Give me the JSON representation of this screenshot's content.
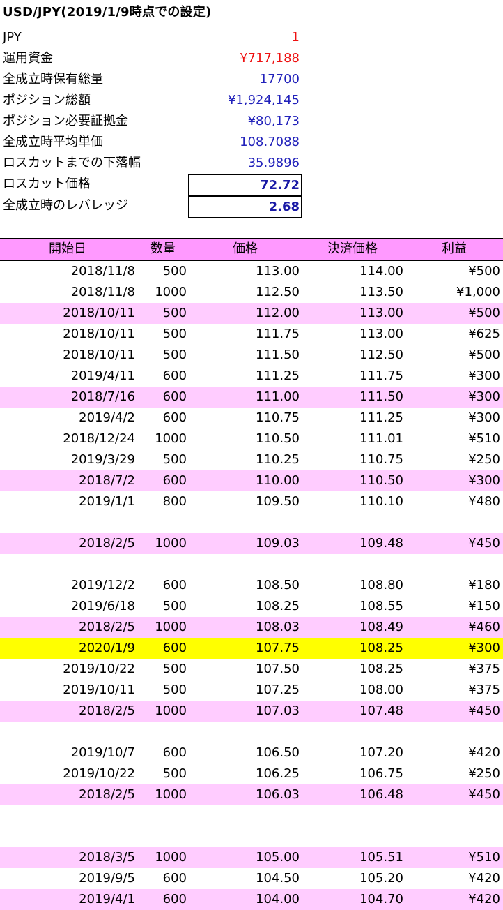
{
  "title": "USD/JPY(2019/1/9時点での設定)",
  "summary": [
    {
      "label": "JPY",
      "value": "1",
      "color": "red"
    },
    {
      "label": "運用資金",
      "value": "¥717,188",
      "color": "red"
    },
    {
      "label": "全成立時保有総量",
      "value": "17700",
      "color": "blue"
    },
    {
      "label": "ポジション総額",
      "value": "¥1,924,145",
      "color": "blue"
    },
    {
      "label": "ポジション必要証拠金",
      "value": "¥80,173",
      "color": "blue"
    },
    {
      "label": "全成立時平均単価",
      "value": "108.7088",
      "color": "blue"
    },
    {
      "label": "ロスカットまでの下落幅",
      "value": "35.9896",
      "color": "blue"
    },
    {
      "label": "ロスカット価格",
      "value": "72.72",
      "color": "bold"
    },
    {
      "label": "全成立時のレバレッジ",
      "value": "2.68",
      "color": "bold"
    }
  ],
  "table": {
    "headers": [
      "開始日",
      "数量",
      "価格",
      "決済価格",
      "利益"
    ],
    "rows": [
      {
        "bg": "white",
        "cells": [
          "2018/11/8",
          "500",
          "113.00",
          "114.00",
          "¥500"
        ]
      },
      {
        "bg": "white",
        "cells": [
          "2018/11/8",
          "1000",
          "112.50",
          "113.50",
          "¥1,000"
        ]
      },
      {
        "bg": "pink",
        "cells": [
          "2018/10/11",
          "500",
          "112.00",
          "113.00",
          "¥500"
        ]
      },
      {
        "bg": "white",
        "cells": [
          "2018/10/11",
          "500",
          "111.75",
          "113.00",
          "¥625"
        ]
      },
      {
        "bg": "white",
        "cells": [
          "2018/10/11",
          "500",
          "111.50",
          "112.50",
          "¥500"
        ]
      },
      {
        "bg": "white",
        "cells": [
          "2019/4/11",
          "600",
          "111.25",
          "111.75",
          "¥300"
        ]
      },
      {
        "bg": "pink",
        "cells": [
          "2018/7/16",
          "600",
          "111.00",
          "111.50",
          "¥300"
        ]
      },
      {
        "bg": "white",
        "cells": [
          "2019/4/2",
          "600",
          "110.75",
          "111.25",
          "¥300"
        ]
      },
      {
        "bg": "white",
        "cells": [
          "2018/12/24",
          "1000",
          "110.50",
          "111.01",
          "¥510"
        ]
      },
      {
        "bg": "white",
        "cells": [
          "2019/3/29",
          "500",
          "110.25",
          "110.75",
          "¥250"
        ]
      },
      {
        "bg": "pink",
        "cells": [
          "2018/7/2",
          "600",
          "110.00",
          "110.50",
          "¥300"
        ]
      },
      {
        "bg": "white",
        "cells": [
          "2019/1/1",
          "800",
          "109.50",
          "110.10",
          "¥480"
        ]
      },
      {
        "bg": "white",
        "cells": [
          "",
          "",
          "",
          "",
          ""
        ]
      },
      {
        "bg": "pink",
        "cells": [
          "2018/2/5",
          "1000",
          "109.03",
          "109.48",
          "¥450"
        ]
      },
      {
        "bg": "white",
        "cells": [
          "",
          "",
          "",
          "",
          ""
        ]
      },
      {
        "bg": "white",
        "cells": [
          "2019/12/2",
          "600",
          "108.50",
          "108.80",
          "¥180"
        ]
      },
      {
        "bg": "white",
        "cells": [
          "2019/6/18",
          "500",
          "108.25",
          "108.55",
          "¥150"
        ]
      },
      {
        "bg": "pink",
        "cells": [
          "2018/2/5",
          "1000",
          "108.03",
          "108.49",
          "¥460"
        ]
      },
      {
        "bg": "yellow",
        "cells": [
          "2020/1/9",
          "600",
          "107.75",
          "108.25",
          "¥300"
        ]
      },
      {
        "bg": "white",
        "cells": [
          "2019/10/22",
          "500",
          "107.50",
          "108.25",
          "¥375"
        ]
      },
      {
        "bg": "white",
        "cells": [
          "2019/10/11",
          "500",
          "107.25",
          "108.00",
          "¥375"
        ]
      },
      {
        "bg": "pink",
        "cells": [
          "2018/2/5",
          "1000",
          "107.03",
          "107.48",
          "¥450"
        ]
      },
      {
        "bg": "white",
        "cells": [
          "",
          "",
          "",
          "",
          ""
        ]
      },
      {
        "bg": "white",
        "cells": [
          "2019/10/7",
          "600",
          "106.50",
          "107.20",
          "¥420"
        ]
      },
      {
        "bg": "white",
        "cells": [
          "2019/10/22",
          "500",
          "106.25",
          "106.75",
          "¥250"
        ]
      },
      {
        "bg": "pink",
        "cells": [
          "2018/2/5",
          "1000",
          "106.03",
          "106.48",
          "¥450"
        ]
      },
      {
        "bg": "white",
        "cells": [
          "",
          "",
          "",
          "",
          ""
        ]
      },
      {
        "bg": "white",
        "cells": [
          "",
          "",
          "",
          "",
          ""
        ]
      },
      {
        "bg": "pink",
        "cells": [
          "2018/3/5",
          "1000",
          "105.00",
          "105.51",
          "¥510"
        ]
      },
      {
        "bg": "white",
        "cells": [
          "2019/9/5",
          "600",
          "104.50",
          "105.20",
          "¥420"
        ]
      },
      {
        "bg": "pink",
        "cells": [
          "2019/4/1",
          "600",
          "104.00",
          "104.70",
          "¥420"
        ]
      }
    ]
  }
}
